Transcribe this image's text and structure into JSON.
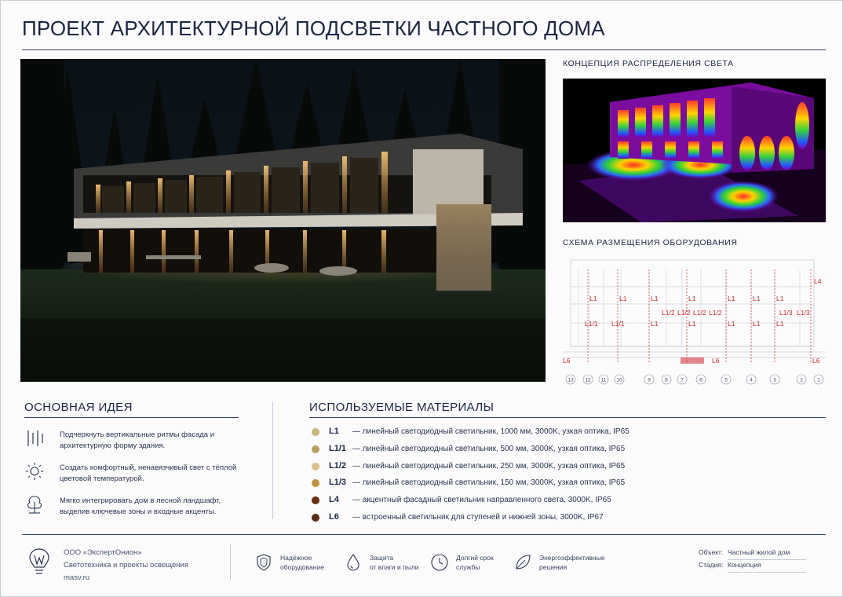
{
  "title": "ПРОЕКТ АРХИТЕКТУРНОЙ ПОДСВЕТКИ ЧАСТНОГО ДОМА",
  "concept": {
    "heading": "КОНЦЕПЦИЯ РАСПРЕДЕЛЕНИЯ СВЕТА"
  },
  "scheme": {
    "heading": "СХЕМА РАЗМЕЩЕНИЯ ОБОРУДОВАНИЯ",
    "labels_upper": [
      "L1",
      "L1",
      "L1",
      "L1",
      "L1",
      "L1",
      "L1"
    ],
    "labels_mid": [
      "L1/2",
      "L1/2",
      "L1/2",
      "L1/2",
      "L1/3",
      "L1/3"
    ],
    "labels_lower": [
      "L1/1",
      "L1/1",
      "L1",
      "L1",
      "L1",
      "L1",
      "L1"
    ],
    "label_l4": "L4",
    "labels_l6": [
      "L6",
      "L6",
      "L6"
    ],
    "axes": [
      "13",
      "12",
      "11",
      "10",
      "9",
      "8",
      "7",
      "6",
      "5",
      "4",
      "3",
      "2",
      "1"
    ]
  },
  "idea": {
    "heading": "ОСНОВНАЯ ИДЕЯ",
    "items": [
      {
        "icon": "vertical-lines-icon",
        "text": "Подчеркнуть вертикальные ритмы фасада и архитектурную форму здания."
      },
      {
        "icon": "sun-icon",
        "text": "Создать комфортный, ненавязчивый свет с тёплой цветовой температурой."
      },
      {
        "icon": "tree-icon",
        "text": "Мягко интегрировать дом в лесной ландшафт, выделив ключевые зоны и входные акценты."
      }
    ]
  },
  "materials": {
    "heading": "ИСПОЛЬЗУЕМЫЕ МАТЕРИАЛЫ",
    "items": [
      {
        "code": "L1",
        "color": "#c9b37c",
        "desc": "— линейный светодиодный светильник, 1000 мм, 3000K, узкая оптика, IP65"
      },
      {
        "code": "L1/1",
        "color": "#b8a062",
        "desc": "— линейный светодиодный светильник, 500 мм, 3000K, узкая оптика, IP65"
      },
      {
        "code": "L1/2",
        "color": "#d8c08a",
        "desc": "— линейный светодиодный светильник, 250 мм, 3000K, узкая оптика, IP65"
      },
      {
        "code": "L1/3",
        "color": "#c0913a",
        "desc": "— линейный светодиодный светильник, 150 мм, 3000K, узкая оптика, IP65"
      },
      {
        "code": "L4",
        "color": "#6b2f14",
        "desc": "— акцентный фасадный светильник направленного света, 3000K, IP65"
      },
      {
        "code": "L6",
        "color": "#5a2a14",
        "desc": "— встроенный светильник для ступеней и нижней зоны, 3000K, IP67"
      }
    ]
  },
  "footer": {
    "company": "ООО «ЭкспертОнион»",
    "tagline": "Светотехника и проекты освещения",
    "site": "masv.ru",
    "features": [
      {
        "icon": "shield-icon",
        "line1": "Надёжное",
        "line2": "оборудование"
      },
      {
        "icon": "drop-icon",
        "line1": "Защита",
        "line2": "от влаги и пыли"
      },
      {
        "icon": "clock-icon",
        "line1": "Долгий срок",
        "line2": "службы"
      },
      {
        "icon": "leaf-icon",
        "line1": "Энергоэффективные",
        "line2": "решения"
      }
    ],
    "object_label": "Объект:",
    "object_value": "Частный жилой дом",
    "stage_label": "Стадия:",
    "stage_value": "Концепция"
  },
  "colors": {
    "accent": "#1b2540",
    "marker": "#d0262a",
    "warm_light": "#f0b060"
  }
}
